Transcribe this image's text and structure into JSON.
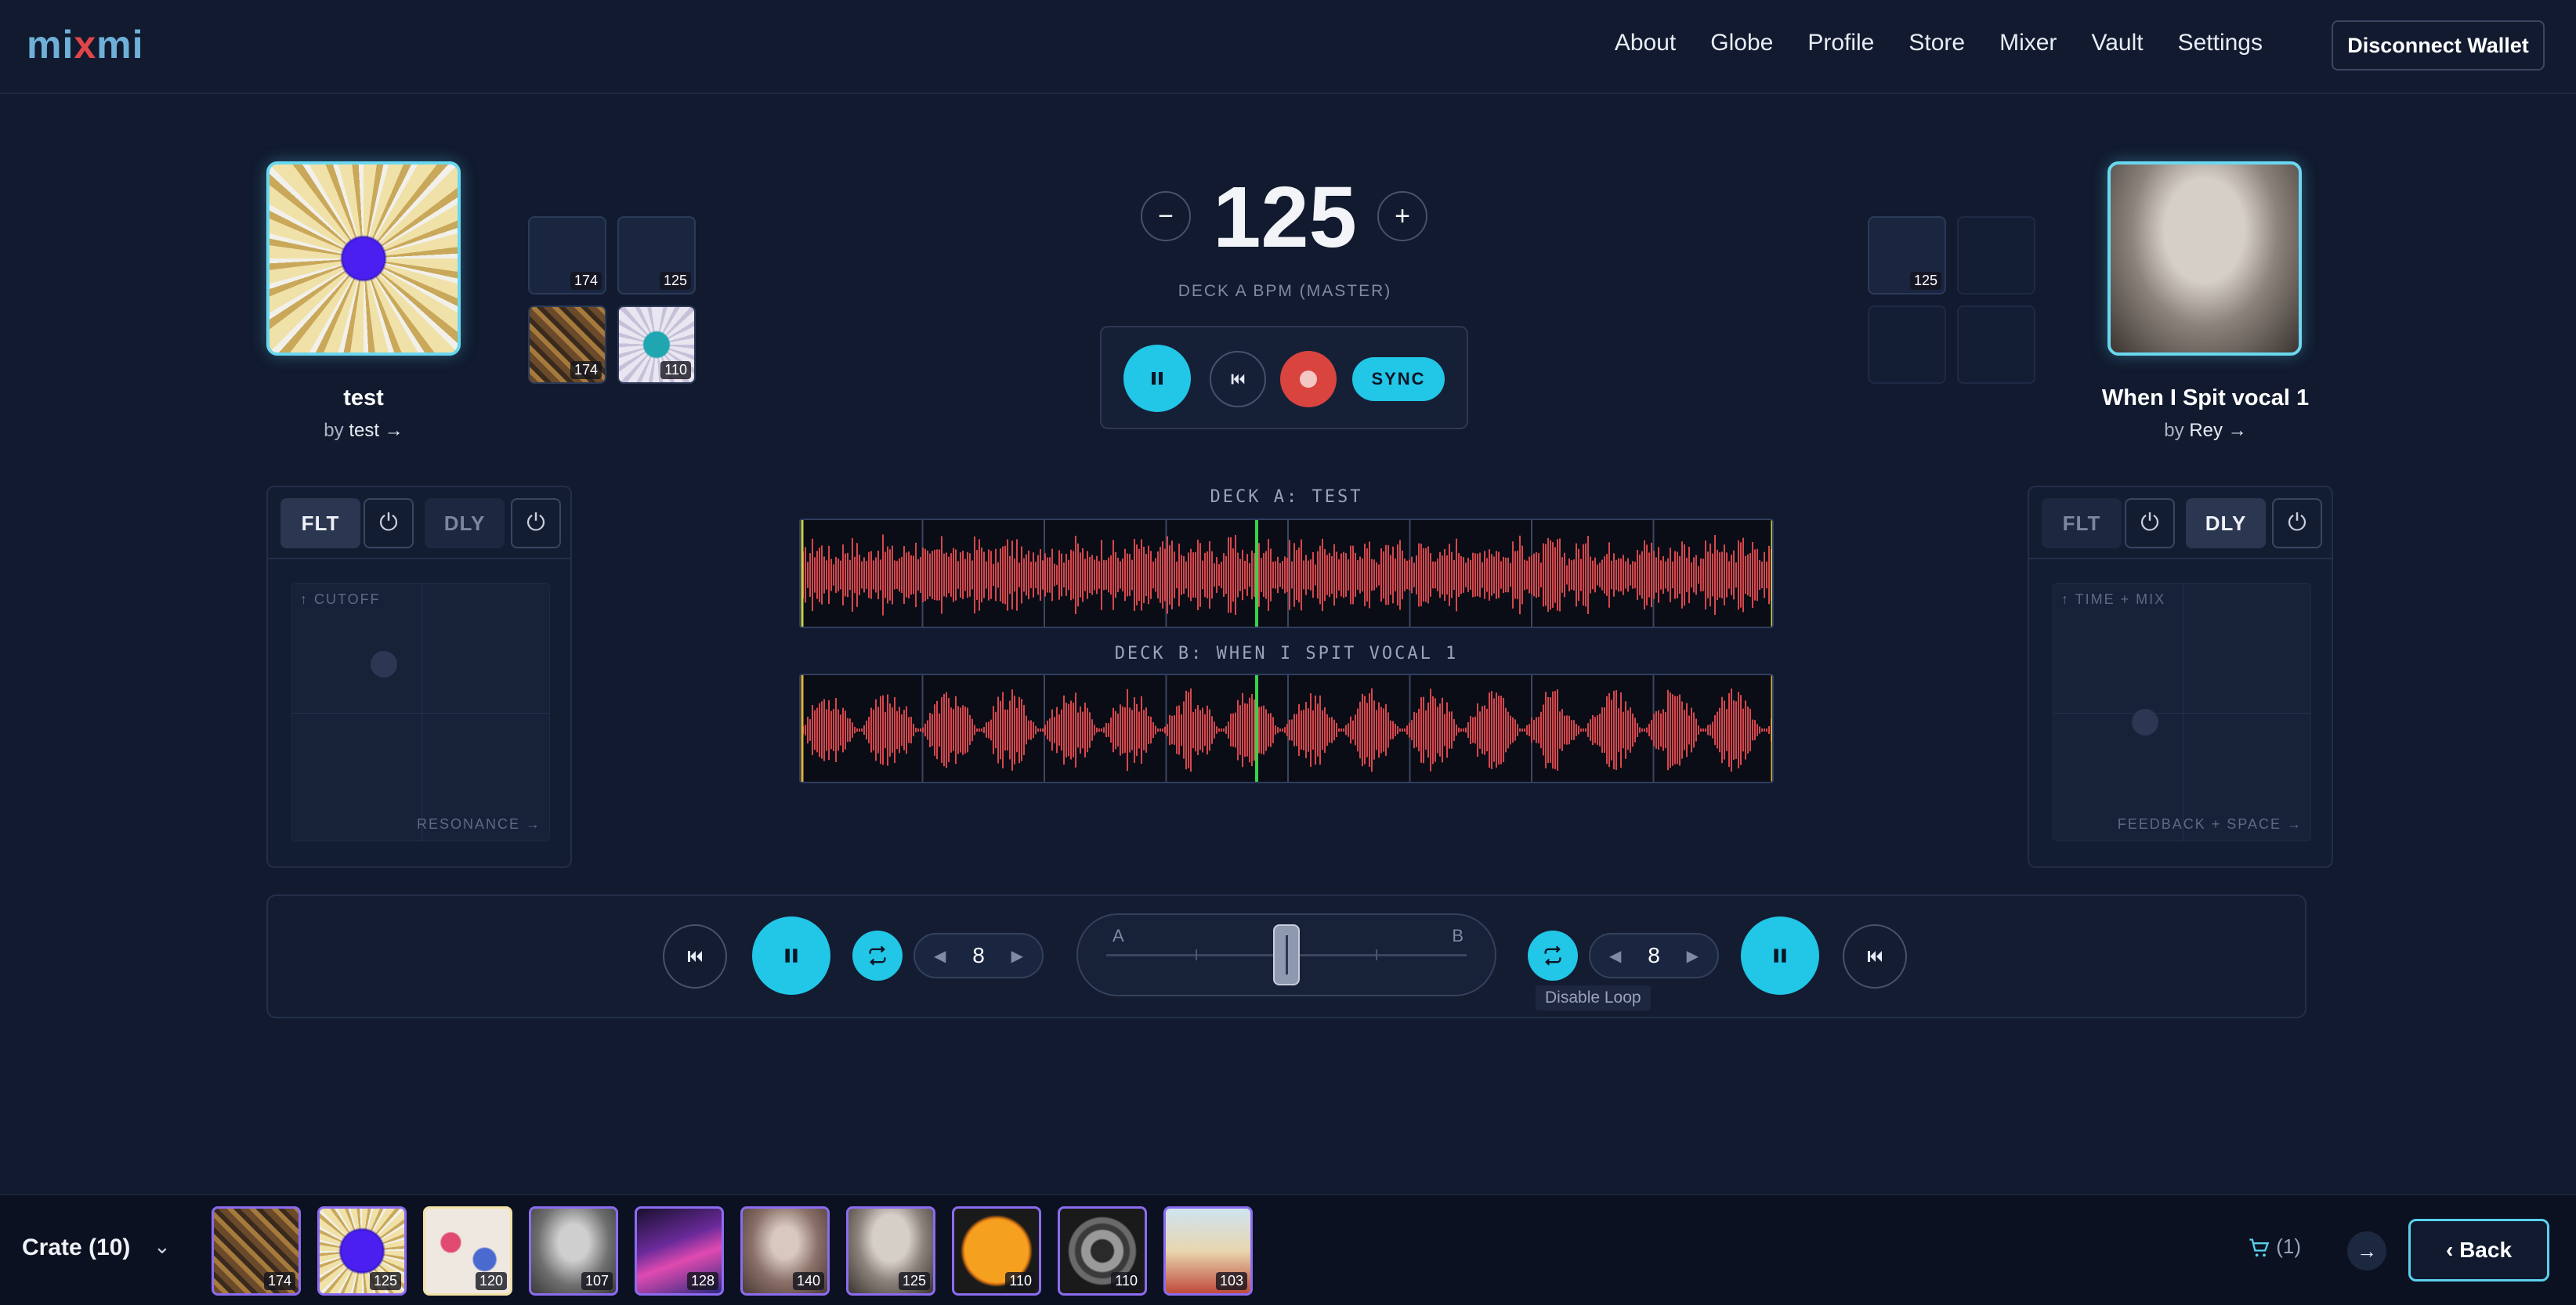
{
  "app": {
    "logo_part1": "mi",
    "logo_x": "x",
    "logo_part2": "mi"
  },
  "nav": {
    "items": [
      "About",
      "Globe",
      "Profile",
      "Store",
      "Mixer",
      "Vault",
      "Settings"
    ],
    "wallet": "Disconnect Wallet"
  },
  "deck_a": {
    "title": "test",
    "by_prefix": "by",
    "artist": "test →",
    "bpm_badges": [
      "174",
      "125",
      "174",
      "110"
    ]
  },
  "deck_b": {
    "title": "When I Spit vocal 1",
    "by_prefix": "by",
    "artist": "Rey →",
    "bpm_badges": [
      "125"
    ]
  },
  "master": {
    "bpm": "125",
    "label": "DECK A BPM (MASTER)",
    "minus": "−",
    "plus": "+",
    "sync": "SYNC"
  },
  "waveforms": {
    "a_label": "DECK A: TEST",
    "b_label": "DECK B: WHEN I SPIT VOCAL 1"
  },
  "fx_left": {
    "flt": "FLT",
    "dly": "DLY",
    "active": "FLT",
    "y_label": "↑ CUTOFF",
    "x_label": "RESONANCE →"
  },
  "fx_right": {
    "flt": "FLT",
    "dly": "DLY",
    "active": "DLY",
    "y_label": "↑ TIME + MIX",
    "x_label": "FEEDBACK + SPACE →"
  },
  "controls": {
    "loop_a": "8",
    "loop_b": "8",
    "crossfader_a": "A",
    "crossfader_b": "B",
    "crossfader_position": 0.5,
    "tooltip": "Disable Loop"
  },
  "crate": {
    "label": "Crate (10)",
    "items": [
      "174",
      "125",
      "120",
      "107",
      "128",
      "140",
      "125",
      "110",
      "110",
      "103"
    ],
    "cart": "(1)",
    "back": "Back"
  },
  "colors": {
    "accent": "#22c6e6",
    "record": "#d9443f",
    "wave": "#d6474c",
    "playhead": "#39d24a"
  }
}
